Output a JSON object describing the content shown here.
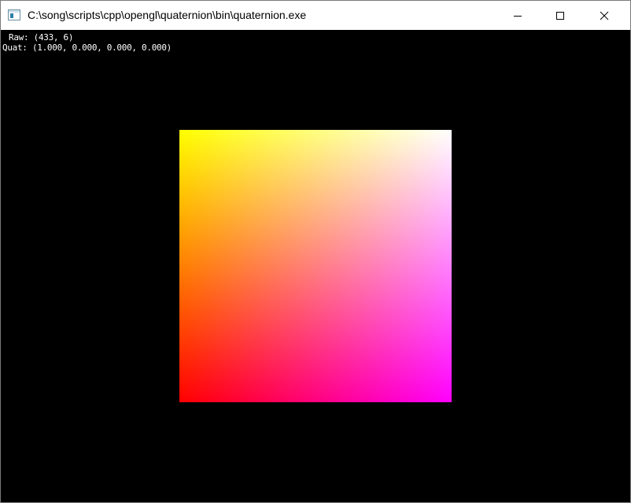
{
  "window": {
    "title": "C:\\song\\scripts\\cpp\\opengl\\quaternion\\bin\\quaternion.exe",
    "controls": {
      "minimize": "minimize-icon",
      "maximize": "maximize-icon",
      "close": "close-icon"
    }
  },
  "overlay": {
    "raw_label": "Raw:",
    "raw_value": "(433, 6)",
    "quat_label": "Quat:",
    "quat_value": "(1.000, 0.000, 0.000, 0.000)"
  },
  "scene": {
    "background_color": "#000000",
    "quad_colors": {
      "top_left": "#ffff00",
      "top_right": "#ffffff",
      "bottom_left": "#ff0000",
      "bottom_right": "#ff00ff"
    }
  }
}
